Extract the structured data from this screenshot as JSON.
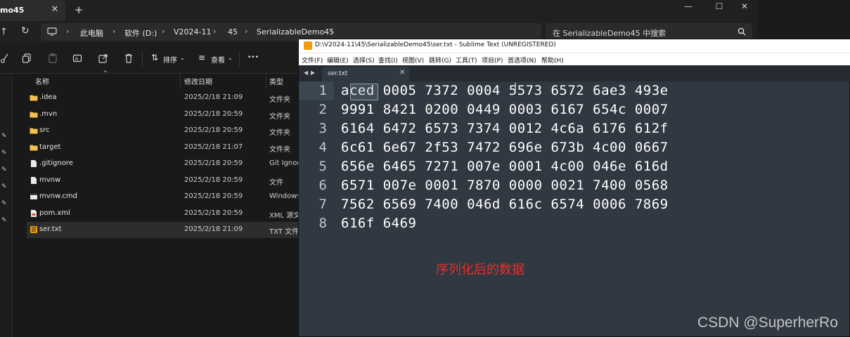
{
  "explorer": {
    "tab_title": "mo45",
    "tab_close": "✕",
    "new_tab": "+",
    "window_controls": {
      "minimize": "—",
      "maximize": "☐",
      "close": "✕"
    },
    "breadcrumbs": [
      "此电脑",
      "软件 (D:)",
      "V2024-11",
      "45",
      "SerializableDemo45"
    ],
    "search_placeholder": "在 SerializableDemo45 中搜索",
    "toolbar": {
      "sort_label": "排序",
      "view_label": "查看",
      "more": "•••"
    },
    "columns": {
      "name": "名称",
      "date": "修改日期",
      "type": "类型"
    },
    "files": [
      {
        "name": ".idea",
        "date": "2025/2/18 21:09",
        "type": "文件夹",
        "icon": "folder-icon"
      },
      {
        "name": ".mvn",
        "date": "2025/2/18 20:59",
        "type": "文件夹",
        "icon": "folder-icon"
      },
      {
        "name": "src",
        "date": "2025/2/18 20:59",
        "type": "文件夹",
        "icon": "folder-icon"
      },
      {
        "name": "target",
        "date": "2025/2/18 21:07",
        "type": "文件夹",
        "icon": "folder-icon"
      },
      {
        "name": ".gitignore",
        "date": "2025/2/18 20:59",
        "type": "Git Ignore",
        "icon": "file-icon"
      },
      {
        "name": "mvnw",
        "date": "2025/2/18 20:59",
        "type": "文件",
        "icon": "file-icon"
      },
      {
        "name": "mvnw.cmd",
        "date": "2025/2/18 20:59",
        "type": "Windows",
        "icon": "cmd-file-icon"
      },
      {
        "name": "pom.xml",
        "date": "2025/2/18 20:59",
        "type": "XML 源文件",
        "icon": "xml-file-icon"
      },
      {
        "name": "ser.txt",
        "date": "2025/2/18 21:09",
        "type": "TXT 文件",
        "icon": "sublime-file-icon"
      }
    ]
  },
  "sublime": {
    "title": "D:\\V2024-11\\45\\SerializableDemo45\\ser.txt - Sublime Text (UNREGISTERED)",
    "menu": [
      "文件(F)",
      "编辑(E)",
      "选择(S)",
      "查找(I)",
      "视图(V)",
      "跳转(G)",
      "工具(T)",
      "项目(P)",
      "首选项(N)",
      "帮助(H)"
    ],
    "tab_name": "ser.txt",
    "tab_close": "✕",
    "lines": [
      {
        "num": "1",
        "text": "aced 0005 7372 0004 5573 6572 6ae3 493e"
      },
      {
        "num": "2",
        "text": "9991 8421 0200 0449 0003 6167 654c 0007"
      },
      {
        "num": "3",
        "text": "6164 6472 6573 7374 0012 4c6a 6176 612f"
      },
      {
        "num": "4",
        "text": "6c61 6e67 2f53 7472 696e 673b 4c00 0667"
      },
      {
        "num": "5",
        "text": "656e 6465 7271 007e 0001 4c00 046e 616d"
      },
      {
        "num": "6",
        "text": "6571 007e 0001 7870 0000 0021 7400 0568"
      },
      {
        "num": "7",
        "text": "7562 6569 7400 046d 616c 6574 0006 7869"
      },
      {
        "num": "8",
        "text": "616f 6469"
      }
    ],
    "annotation": "序列化后的数据"
  },
  "watermark": "CSDN @SuperherRo"
}
